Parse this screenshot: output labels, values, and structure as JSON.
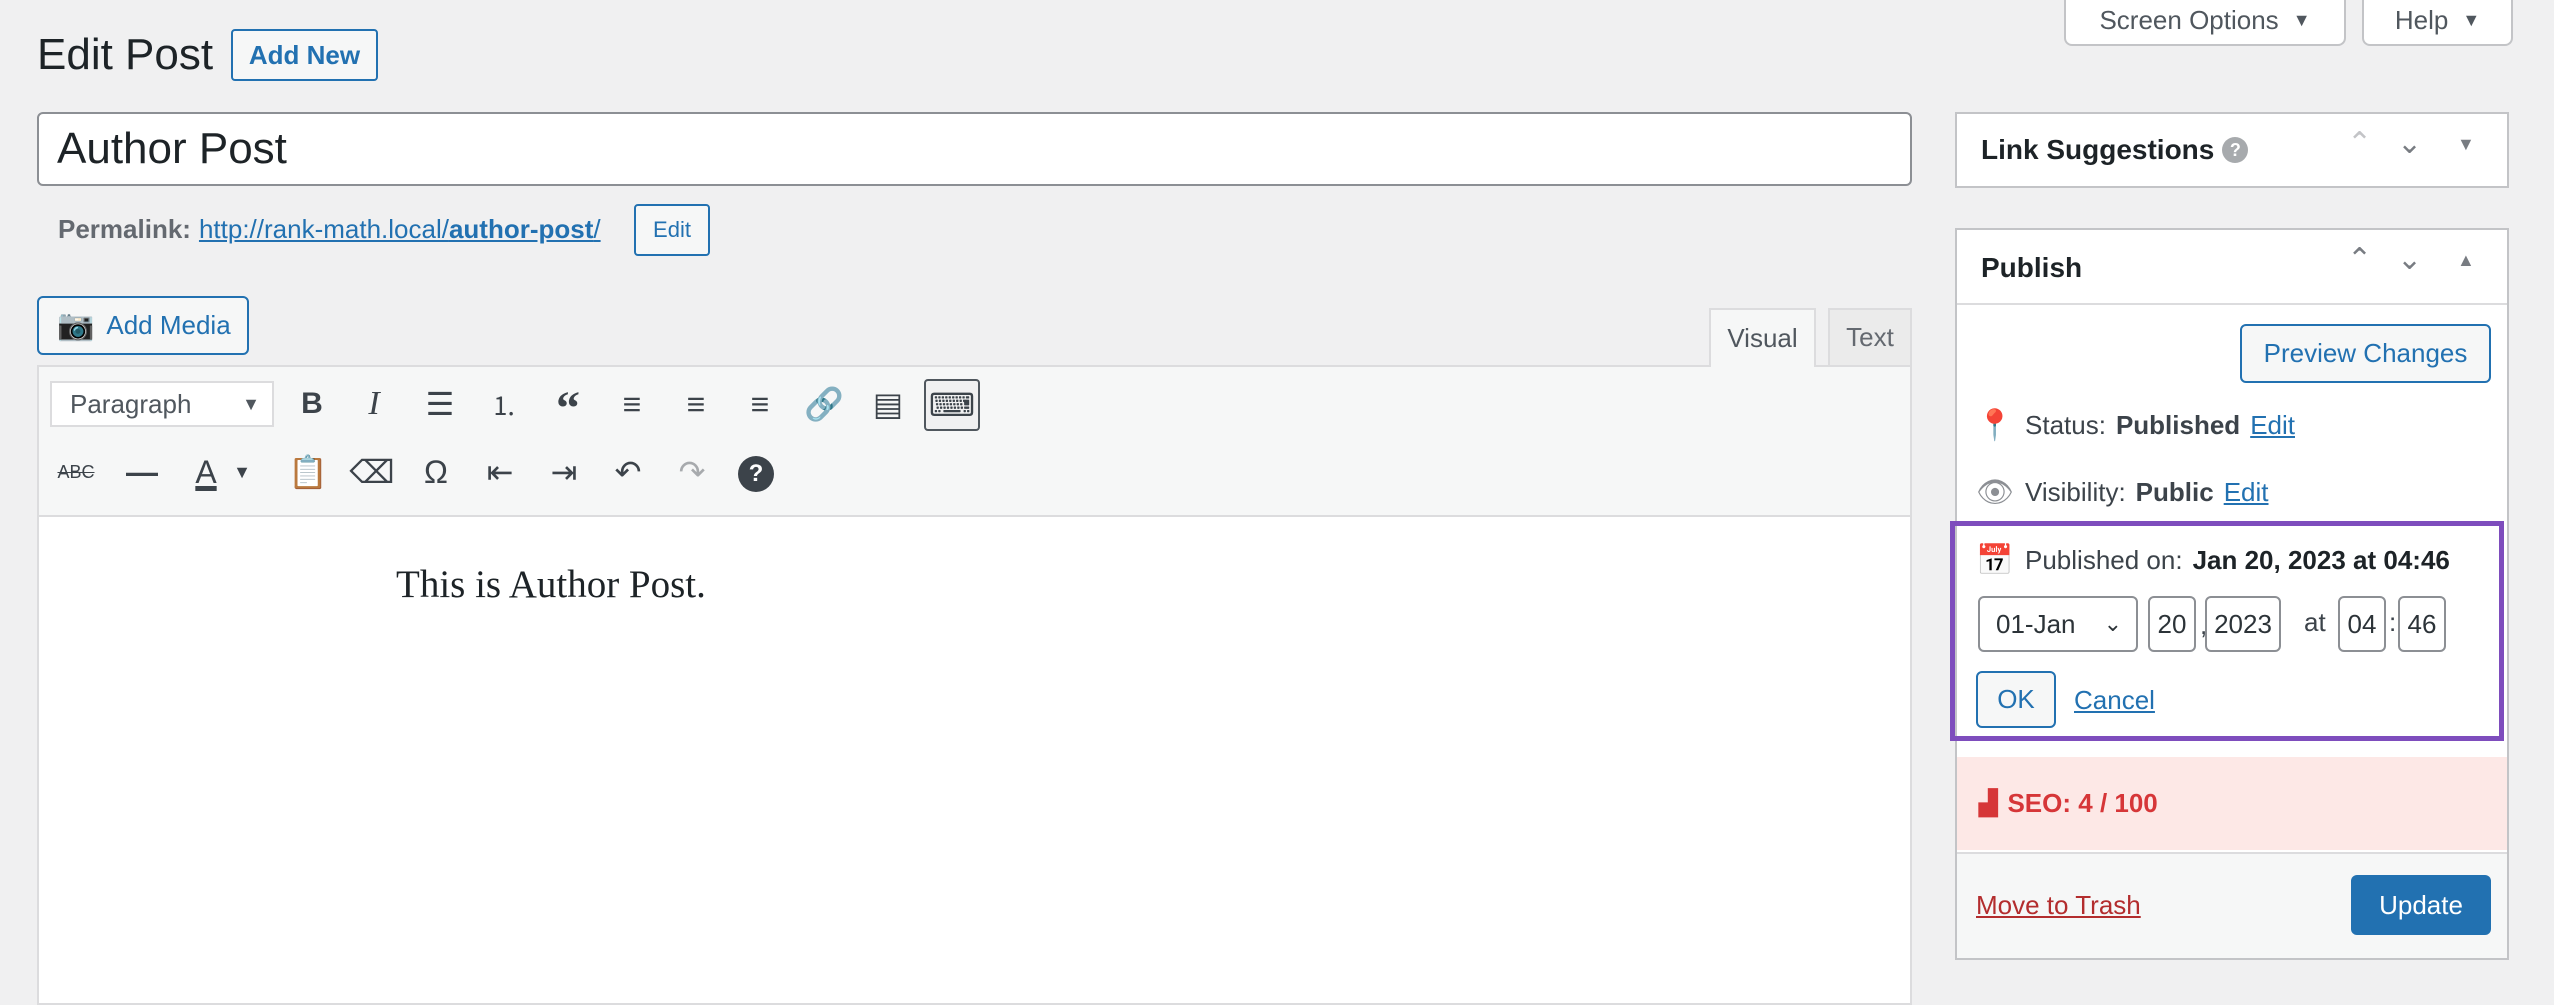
{
  "header": {
    "title": "Edit Post",
    "add_new": "Add New",
    "screen_options": "Screen Options",
    "help": "Help"
  },
  "post": {
    "title": "Author Post",
    "permalink_label": "Permalink:",
    "permalink_base": "http://rank-math.local/",
    "permalink_slug": "author-post",
    "permalink_trailing": "/",
    "permalink_edit": "Edit"
  },
  "editor": {
    "add_media": "Add Media",
    "tabs": [
      {
        "label": "Visual",
        "active": true
      },
      {
        "label": "Text",
        "active": false
      }
    ],
    "format_select": "Paragraph",
    "content": "This is Author Post.",
    "toolbar_row1": [
      "bold-icon",
      "italic-icon",
      "bulleted-list-icon",
      "numbered-list-icon",
      "blockquote-icon",
      "align-left-icon",
      "align-center-icon",
      "align-right-icon",
      "link-icon",
      "read-more-icon",
      "toolbar-toggle-icon"
    ],
    "toolbar_row2": [
      "strikethrough-icon",
      "horizontal-line-icon",
      "text-color-icon",
      "paste-as-text-icon",
      "clear-formatting-icon",
      "special-character-icon",
      "outdent-icon",
      "indent-icon",
      "undo-icon",
      "redo-icon",
      "help-icon"
    ]
  },
  "sidebar": {
    "link_suggestions": {
      "title": "Link Suggestions"
    },
    "publish": {
      "title": "Publish",
      "preview": "Preview Changes",
      "status_label": "Status:",
      "status_value": "Published",
      "status_edit": "Edit",
      "visibility_label": "Visibility:",
      "visibility_value": "Public",
      "visibility_edit": "Edit",
      "published_label": "Published on:",
      "published_value": "Jan 20, 2023 at 04:46",
      "month": "01-Jan",
      "day": "20",
      "comma": ",",
      "year": "2023",
      "at": "at",
      "hour": "04",
      "colon": ":",
      "minute": "46",
      "ok": "OK",
      "cancel": "Cancel",
      "seo": "SEO: 4 / 100",
      "trash": "Move to Trash",
      "update": "Update"
    }
  },
  "colors": {
    "accent": "#2271b1",
    "highlight": "#7e4dbd",
    "seo_bg": "#fde8e6",
    "seo_text": "#d63638",
    "trash": "#b32d2e"
  }
}
